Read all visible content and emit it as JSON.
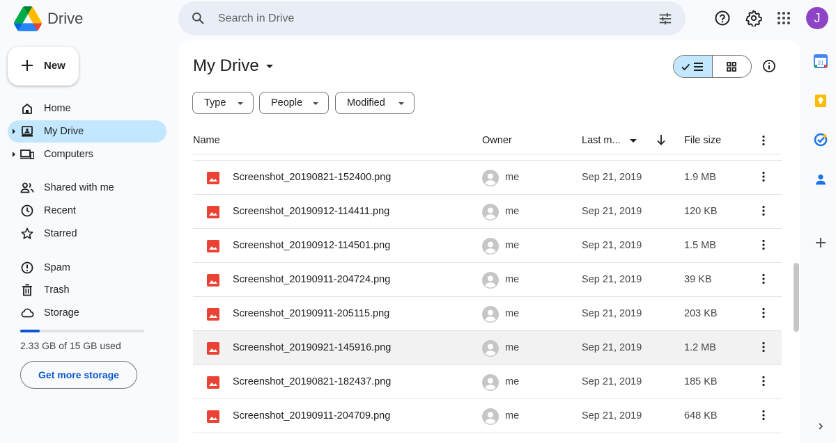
{
  "app": {
    "name": "Drive"
  },
  "search": {
    "placeholder": "Search in Drive"
  },
  "user": {
    "initial": "J",
    "avatar_color": "#8e44c7"
  },
  "sidebar": {
    "new_label": "New",
    "items": [
      {
        "label": "Home",
        "icon": "home-icon"
      },
      {
        "label": "My Drive",
        "icon": "my-drive-icon",
        "active": true
      },
      {
        "label": "Computers",
        "icon": "computers-icon"
      },
      {
        "label": "Shared with me",
        "icon": "shared-icon"
      },
      {
        "label": "Recent",
        "icon": "clock-icon"
      },
      {
        "label": "Starred",
        "icon": "star-icon"
      },
      {
        "label": "Spam",
        "icon": "spam-icon"
      },
      {
        "label": "Trash",
        "icon": "trash-icon"
      },
      {
        "label": "Storage",
        "icon": "cloud-icon"
      }
    ],
    "storage": {
      "used_text": "2.33 GB of 15 GB used",
      "fraction_used": 0.155,
      "button_label": "Get more storage"
    }
  },
  "main": {
    "title": "My Drive",
    "filters": [
      "Type",
      "People",
      "Modified"
    ],
    "columns": {
      "name": "Name",
      "owner": "Owner",
      "modified": "Last m...",
      "size": "File size"
    },
    "rows": [
      {
        "name": "Screenshot_20190821-152400.png",
        "owner": "me",
        "date": "Sep 21, 2019",
        "size": "1.9 MB"
      },
      {
        "name": "Screenshot_20190912-114411.png",
        "owner": "me",
        "date": "Sep 21, 2019",
        "size": "120 KB"
      },
      {
        "name": "Screenshot_20190912-114501.png",
        "owner": "me",
        "date": "Sep 21, 2019",
        "size": "1.5 MB"
      },
      {
        "name": "Screenshot_20190911-204724.png",
        "owner": "me",
        "date": "Sep 21, 2019",
        "size": "39 KB"
      },
      {
        "name": "Screenshot_20190911-205115.png",
        "owner": "me",
        "date": "Sep 21, 2019",
        "size": "203 KB"
      },
      {
        "name": "Screenshot_20190921-145916.png",
        "owner": "me",
        "date": "Sep 21, 2019",
        "size": "1.2 MB",
        "hover": true
      },
      {
        "name": "Screenshot_20190821-182437.png",
        "owner": "me",
        "date": "Sep 21, 2019",
        "size": "185 KB"
      },
      {
        "name": "Screenshot_20190911-204709.png",
        "owner": "me",
        "date": "Sep 21, 2019",
        "size": "648 KB"
      }
    ]
  },
  "colors": {
    "accent": "#0b57d0",
    "active_nav": "#c2e7ff",
    "file_icon": "#ea4335"
  }
}
